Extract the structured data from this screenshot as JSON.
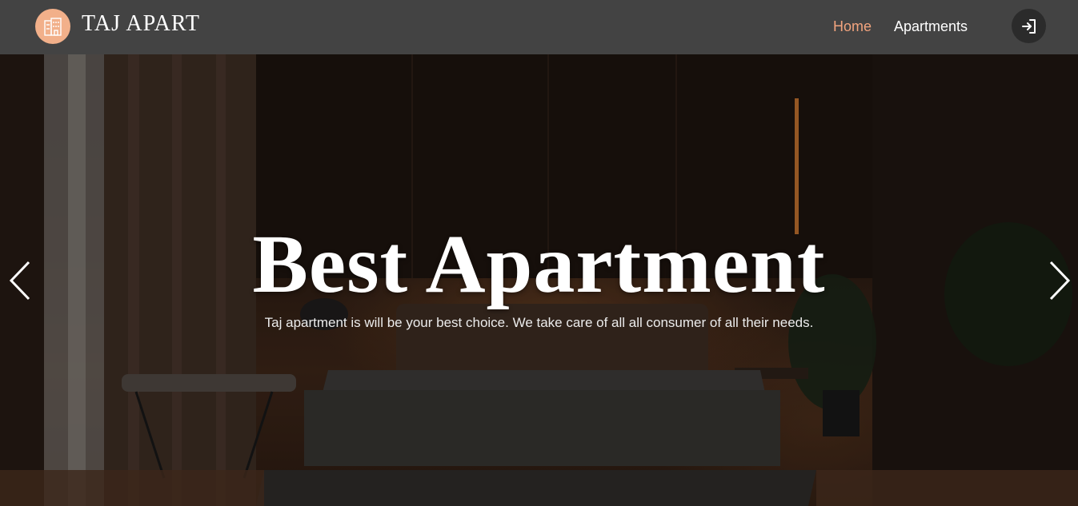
{
  "navbar": {
    "brand": "TAJ APART",
    "logo_icon": "apartment-building-icon",
    "links": [
      {
        "label": "Home",
        "active": true
      },
      {
        "label": "Apartments",
        "active": false
      }
    ],
    "login_icon": "sign-in-icon"
  },
  "hero": {
    "title": "Best Apartment",
    "subtitle": "Taj apartment is will be your best choice. We take care of all all consumer of all their needs.",
    "prev_icon": "chevron-left-icon",
    "next_icon": "chevron-right-icon"
  },
  "colors": {
    "navbar_bg": "#434343",
    "accent": "#f2a47e",
    "logo_bg": "#f2b08a",
    "login_btn_bg": "#2b2b2b"
  }
}
